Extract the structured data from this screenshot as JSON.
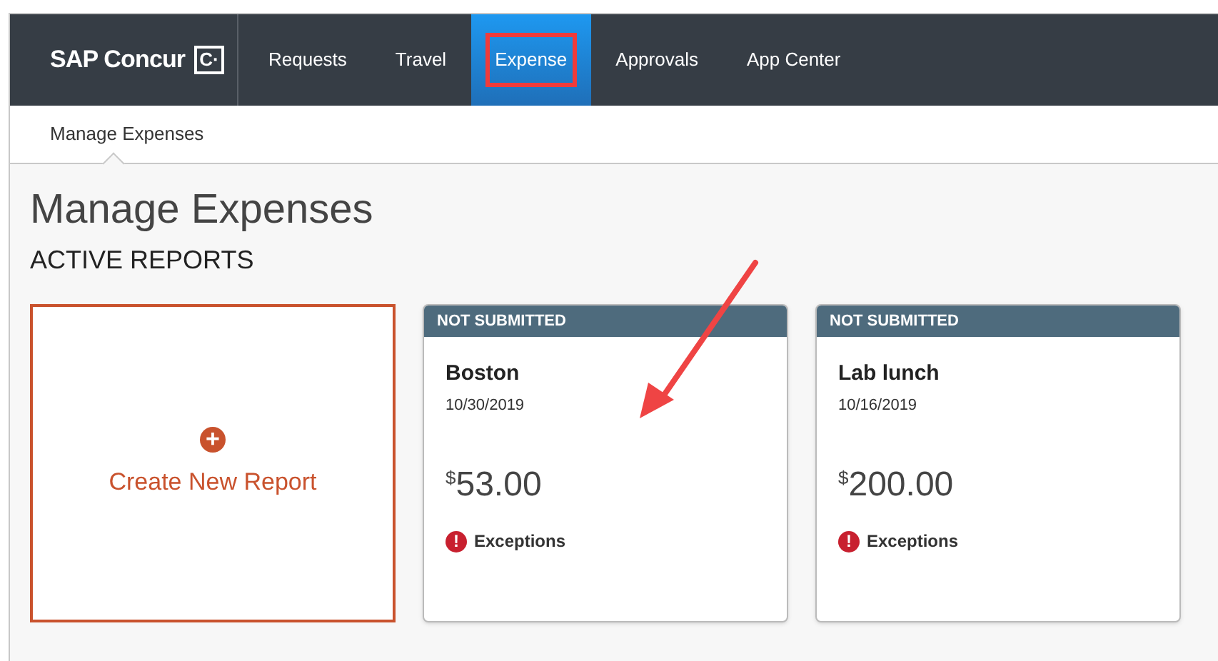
{
  "brand": "SAP Concur",
  "brand_mark": "C·",
  "nav": [
    {
      "label": "Requests",
      "selected": false,
      "highlighted": false
    },
    {
      "label": "Travel",
      "selected": false,
      "highlighted": false
    },
    {
      "label": "Expense",
      "selected": true,
      "highlighted": true
    },
    {
      "label": "Approvals",
      "selected": false,
      "highlighted": false
    },
    {
      "label": "App Center",
      "selected": false,
      "highlighted": false
    }
  ],
  "subnav": [
    {
      "label": "Manage Expenses",
      "selected": true
    }
  ],
  "page_title": "Manage Expenses",
  "section_title": "ACTIVE REPORTS",
  "create_card": {
    "icon": "+",
    "label": "Create New Report"
  },
  "reports": [
    {
      "status": "NOT SUBMITTED",
      "name": "Boston",
      "date": "10/30/2019",
      "currency": "$",
      "amount": "53.00",
      "alert": "!",
      "exceptions": "Exceptions"
    },
    {
      "status": "NOT SUBMITTED",
      "name": "Lab lunch",
      "date": "10/16/2019",
      "currency": "$",
      "amount": "200.00",
      "alert": "!",
      "exceptions": "Exceptions"
    }
  ],
  "annotation": {
    "kind": "arrow"
  }
}
